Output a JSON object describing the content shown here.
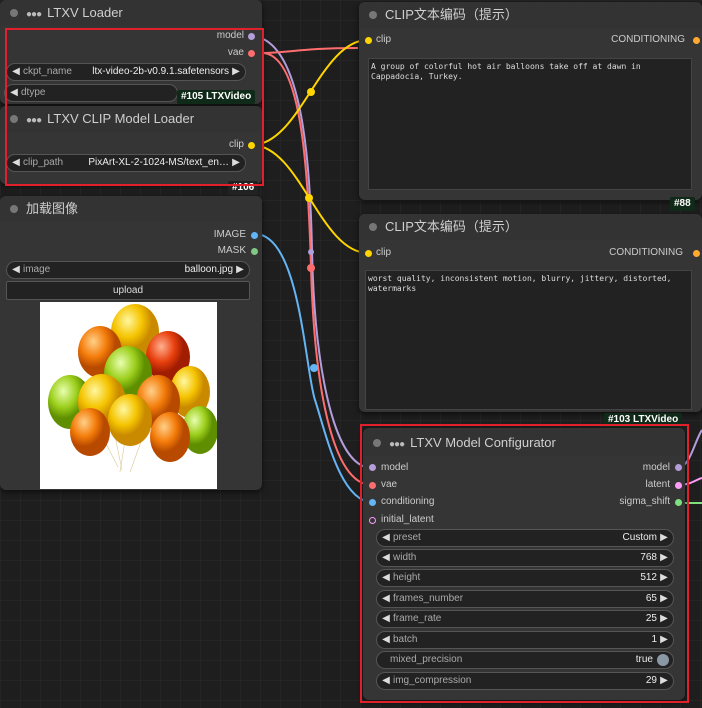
{
  "colors": {
    "model": "#b39ddb",
    "vae": "#ff6e6e",
    "clip": "#ffd500",
    "image": "#64b5f6",
    "mask": "#81c784",
    "latent": "#ff9cf9",
    "sigma": "#7ee07e",
    "conditioning": "#ffa931",
    "highlight": "#e0202a"
  },
  "ltx_loader": {
    "title": "LTXV Loader",
    "outputs": {
      "model": "model",
      "vae": "vae"
    },
    "ckpt_label": "ckpt_name",
    "ckpt_value": "ltx-video-2b-v0.9.1.safetensors",
    "dtype_label": "dtype",
    "badge": "#105 LTXVideo"
  },
  "clip_loader": {
    "title": "LTXV CLIP Model Loader",
    "output": "clip",
    "clip_path_label": "clip_path",
    "clip_path_value": "PixArt-XL-2-1024-MS/text_en…",
    "badge": "#106"
  },
  "load_image": {
    "title": "加载图像",
    "outputs": {
      "image": "IMAGE",
      "mask": "MASK"
    },
    "image_label": "image",
    "image_value": "balloon.jpg",
    "upload_label": "upload"
  },
  "clip_encode_pos": {
    "title": "CLIP文本编码（提示）",
    "input": "clip",
    "output": "CONDITIONING",
    "text": "A group of colorful hot air balloons take off at dawn in Cappadocia, Turkey.",
    "badge": "#88"
  },
  "clip_encode_neg": {
    "title": "CLIP文本编码（提示）",
    "input": "clip",
    "output": "CONDITIONING",
    "text": "worst quality, inconsistent motion, blurry, jittery, distorted, watermarks",
    "badge": "#103 LTXVideo"
  },
  "configurator": {
    "title": "LTXV Model Configurator",
    "inputs": {
      "model": "model",
      "vae": "vae",
      "conditioning": "conditioning",
      "initial_latent": "initial_latent"
    },
    "outputs": {
      "model": "model",
      "latent": "latent",
      "sigma_shift": "sigma_shift"
    },
    "widgets": [
      {
        "label": "preset",
        "value": "Custom"
      },
      {
        "label": "width",
        "value": "768"
      },
      {
        "label": "height",
        "value": "512"
      },
      {
        "label": "frames_number",
        "value": "65"
      },
      {
        "label": "frame_rate",
        "value": "25"
      },
      {
        "label": "batch",
        "value": "1"
      },
      {
        "label": "mixed_precision",
        "value": "true"
      },
      {
        "label": "img_compression",
        "value": "29"
      }
    ]
  }
}
